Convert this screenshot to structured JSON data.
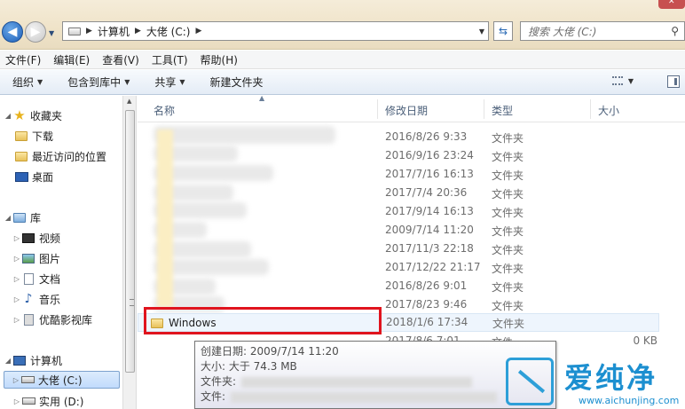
{
  "address": {
    "path": [
      "计算机",
      "大佬 (C:)"
    ],
    "search_placeholder": "搜索 大佬 (C:)"
  },
  "menu": [
    "文件(F)",
    "编辑(E)",
    "查看(V)",
    "工具(T)",
    "帮助(H)"
  ],
  "toolbar": {
    "organize": "组织",
    "include_library": "包含到库中",
    "share": "共享",
    "new_folder": "新建文件夹"
  },
  "nav": {
    "favorites": "收藏夹",
    "downloads": "下载",
    "recent": "最近访问的位置",
    "desktop": "桌面",
    "libraries": "库",
    "videos": "视频",
    "pictures": "图片",
    "documents": "文档",
    "music": "音乐",
    "youku": "优酷影视库",
    "computer": "计算机",
    "drive_c": "大佬 (C:)",
    "drive_d": "实用 (D:)"
  },
  "columns": {
    "name": "名称",
    "modified": "修改日期",
    "type": "类型",
    "size": "大小"
  },
  "rows": [
    {
      "date": "2016/8/26 9:33",
      "type": "文件夹"
    },
    {
      "date": "2016/9/16 23:24",
      "type": "文件夹"
    },
    {
      "date": "2017/7/16 16:13",
      "type": "文件夹"
    },
    {
      "date": "2017/7/4 20:36",
      "type": "文件夹"
    },
    {
      "date": "2017/9/14 16:13",
      "type": "文件夹"
    },
    {
      "date": "2009/7/14 11:20",
      "type": "文件夹"
    },
    {
      "date": "2017/11/3 22:18",
      "type": "文件夹"
    },
    {
      "date": "2017/12/22 21:17",
      "type": "文件夹"
    },
    {
      "date": "2016/8/26 9:01",
      "type": "文件夹"
    },
    {
      "date": "2017/8/23 9:46",
      "type": "文件夹"
    }
  ],
  "windows_row": {
    "name": "Windows",
    "date": "2018/1/6 17:34",
    "type": "文件夹"
  },
  "partial_row": {
    "date": "2017/8/6 7:01",
    "type": "文件",
    "size": "0 KB"
  },
  "tooltip": {
    "created": "创建日期: 2009/7/14 11:20",
    "size": "大小: 大于 74.3 MB",
    "folders": "文件夹:",
    "files": "文件:"
  },
  "watermark": {
    "title": "爱纯净",
    "url": "www.aichunjing.com"
  },
  "colors": {
    "selection_border": "#e0141e",
    "accent": "#1c8fd0"
  }
}
